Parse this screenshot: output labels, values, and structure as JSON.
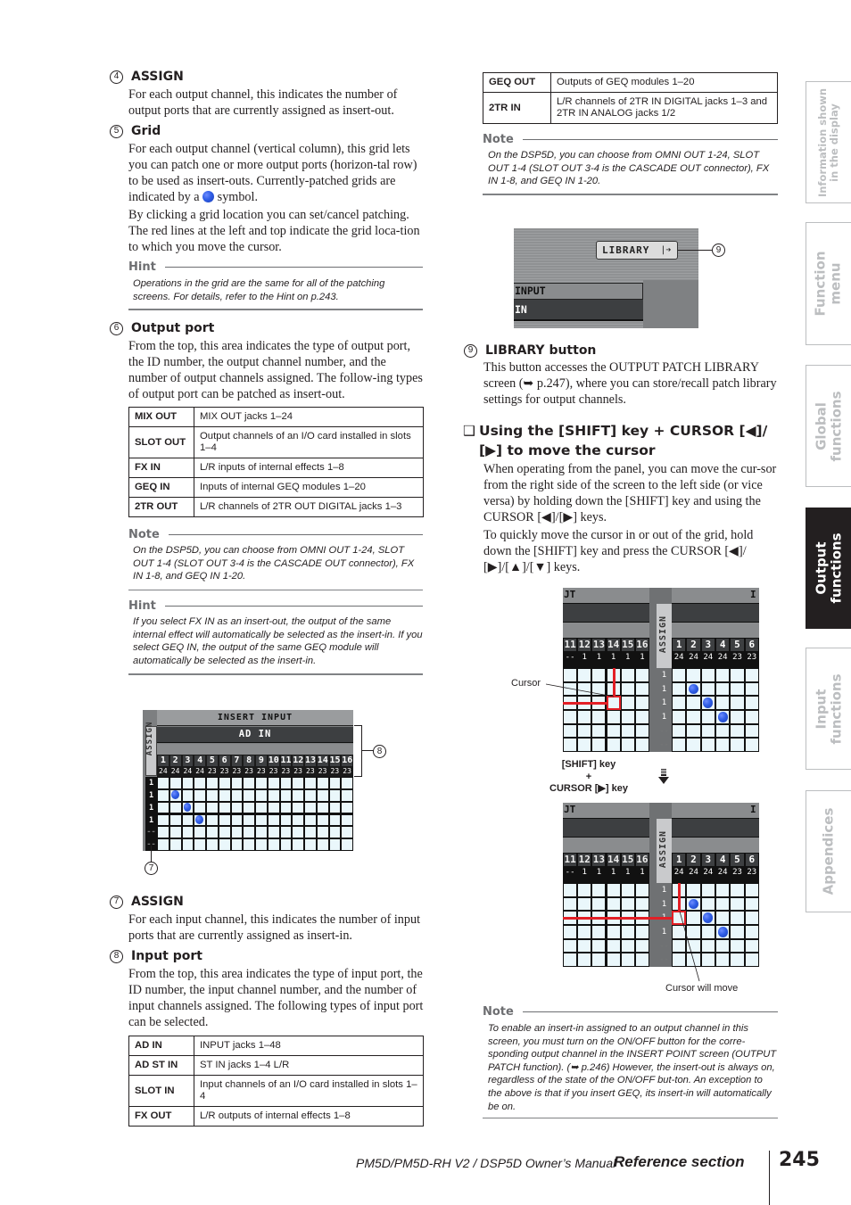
{
  "left_column": {
    "item4": {
      "number": "4",
      "title": "ASSIGN",
      "body": "For each output channel, this indicates the number of output ports that are currently assigned as insert-out."
    },
    "item5": {
      "number": "5",
      "title": "Grid",
      "body1_a": "For each output channel (vertical column), this grid lets you can patch one or more output ports (horizon-tal row) to be used as insert-outs. Currently-patched grids are indicated by a",
      "body1_b": "symbol.",
      "body2": "By clicking a grid location you can set/cancel patching. The red lines at the left and top indicate the grid loca-tion to which you move the cursor."
    },
    "hint1": {
      "label": "Hint",
      "text": "Operations in the grid are the same for all of the patching screens. For details, refer to the Hint on p.243."
    },
    "item6": {
      "number": "6",
      "title": "Output port",
      "body": "From the top, this area indicates the type of output port, the ID number, the output channel number, and the number of output channels assigned. The follow-ing types of output port can be patched as insert-out."
    },
    "output_port_table": [
      {
        "port": "MIX OUT",
        "desc": "MIX OUT jacks 1–24"
      },
      {
        "port": "SLOT OUT",
        "desc": "Output channels of an I/O card installed in slots 1–4"
      },
      {
        "port": "FX IN",
        "desc": "L/R inputs of internal effects 1–8"
      },
      {
        "port": "GEQ IN",
        "desc": "Inputs of internal GEQ modules 1–20"
      },
      {
        "port": "2TR OUT",
        "desc": "L/R channels of 2TR OUT DIGITAL jacks 1–3"
      }
    ],
    "note1": {
      "label": "Note",
      "text": "On the DSP5D, you can choose from OMNI OUT 1-24, SLOT OUT 1-4 (SLOT OUT 3-4 is the CASCADE OUT connector), FX IN 1-8, and GEQ IN 1-20."
    },
    "hint2": {
      "label": "Hint",
      "text": "If you select FX IN as an insert-out, the output of the same internal effect will automatically be selected as the insert-in. If you select GEQ IN, the output of the same GEQ module will automatically be selected as the insert-in."
    },
    "insert_screen": {
      "header": "INSERT INPUT",
      "port_type": "AD IN",
      "assign_label": "ASSIGN",
      "channels": [
        "1",
        "2",
        "3",
        "4",
        "5",
        "6",
        "7",
        "8",
        "9",
        "10",
        "11",
        "12",
        "13",
        "14",
        "15",
        "16"
      ],
      "assigned_counts": [
        "24",
        "24",
        "24",
        "24",
        "23",
        "23",
        "23",
        "23",
        "23",
        "23",
        "23",
        "23",
        "23",
        "23",
        "23",
        "23"
      ],
      "row_assign": [
        "1",
        "1",
        "1",
        "1",
        "--",
        "--"
      ],
      "patched_cells": [
        [
          1,
          1
        ],
        [
          2,
          2
        ],
        [
          3,
          3
        ]
      ],
      "callout_input_port": "8",
      "callout_assign": "7"
    },
    "item7": {
      "number": "7",
      "title": "ASSIGN",
      "body": "For each input channel, this indicates the number of input ports that are currently assigned as insert-in."
    },
    "item8": {
      "number": "8",
      "title": "Input port",
      "body": "From the top, this area indicates the type of input port, the ID number, the input channel number, and the number of input channels assigned. The following types of input port can be selected."
    },
    "input_port_table": [
      {
        "port": "AD IN",
        "desc": "INPUT jacks 1–48"
      },
      {
        "port": "AD ST IN",
        "desc": "ST IN jacks 1–4 L/R"
      },
      {
        "port": "SLOT IN",
        "desc": "Input channels of an I/O card installed in slots 1–4"
      },
      {
        "port": "FX OUT",
        "desc": "L/R outputs of internal effects 1–8"
      }
    ]
  },
  "right_column": {
    "input_port_table_cont": [
      {
        "port": "GEQ OUT",
        "desc": "Outputs of GEQ modules 1–20"
      },
      {
        "port": "2TR IN",
        "desc": "L/R channels of 2TR IN DIGITAL jacks 1–3 and 2TR IN ANALOG jacks 1/2"
      }
    ],
    "note2": {
      "label": "Note",
      "text": "On the DSP5D, you can choose from OMNI OUT 1-24, SLOT OUT 1-4 (SLOT OUT 3-4 is the CASCADE OUT connector), FX IN 1-8, and GEQ IN 1-20."
    },
    "library_screen": {
      "button_label": "LIBRARY",
      "button_icon": "arrow-right-icon",
      "row1": "INPUT",
      "row2": "IN",
      "callout": "9"
    },
    "item9": {
      "number": "9",
      "title": "LIBRARY button",
      "body": "This button accesses the OUTPUT PATCH LIBRARY screen (➥ p.247), where you can store/recall patch library settings for output channels."
    },
    "section": {
      "checkbox": "❑",
      "title": "Using the [SHIFT] key + CURSOR [◀]/ [▶] to move the cursor",
      "para1": "When operating from the panel, you can move the cur-sor from the right side of the screen to the left side (or vice versa) by holding down the [SHIFT] key and using the CURSOR [◀]/[▶] keys.",
      "para2": "To quickly move the cursor in or out of the grid, hold down the [SHIFT] key and press the CURSOR [◀]/ [▶]/[▲]/[▼] keys."
    },
    "cursor_figure": {
      "header_left": "JT",
      "header_right": "I",
      "assign_label": "ASSIGN",
      "left_channels": [
        "11",
        "12",
        "13",
        "14",
        "15",
        "16"
      ],
      "left_counts": [
        "--",
        "1",
        "1",
        "1",
        "1",
        "1"
      ],
      "right_channels": [
        "1",
        "2",
        "3",
        "4",
        "5",
        "6"
      ],
      "right_counts": [
        "24",
        "24",
        "24",
        "24",
        "23",
        "23"
      ],
      "row_assign": [
        "1",
        "1",
        "1",
        "1",
        "--",
        "--"
      ],
      "patched_cells": [
        [
          1,
          1
        ],
        [
          2,
          2
        ],
        [
          3,
          3
        ]
      ],
      "cursor_label": "Cursor",
      "key_line1": "[SHIFT] key",
      "key_line2": "+",
      "key_line3": "CURSOR [▶] key",
      "arrow_icon": "arrow-down-icon",
      "moved_label": "Cursor will move"
    },
    "note3": {
      "label": "Note",
      "text": "To enable an insert-in assigned to an output channel in this screen, you must turn on the ON/OFF button for the corre-sponding output channel in the INSERT POINT screen (OUTPUT PATCH function). (➥ p.246) However, the insert-out is always on, regardless of the state of the ON/OFF but-ton. An exception to the above is that if you insert GEQ, its insert-in will automatically be on."
    }
  },
  "side_tabs": [
    {
      "label_line1": "Information shown",
      "label_line2": "in the display",
      "active": false
    },
    {
      "label_line1": "Function",
      "label_line2": "menu",
      "active": false
    },
    {
      "label_line1": "Global",
      "label_line2": "functions",
      "active": false
    },
    {
      "label_line1": "Output",
      "label_line2": "functions",
      "active": true
    },
    {
      "label_line1": "Input",
      "label_line2": "functions",
      "active": false
    },
    {
      "label_line1": "Appendices",
      "label_line2": "",
      "active": false
    }
  ],
  "footer": {
    "manual": "PM5D/PM5D-RH V2 / DSP5D Owner’s Manual",
    "section": "Reference section",
    "page": "245"
  },
  "colors": {
    "grid_cell": "#eaf7fb",
    "grid_line": "#111111",
    "cursor_red": "#e21f26",
    "patch_dot": "#2f5de6",
    "active_tab": "#231f20",
    "inactive_tab_text": "#bcbec0"
  }
}
